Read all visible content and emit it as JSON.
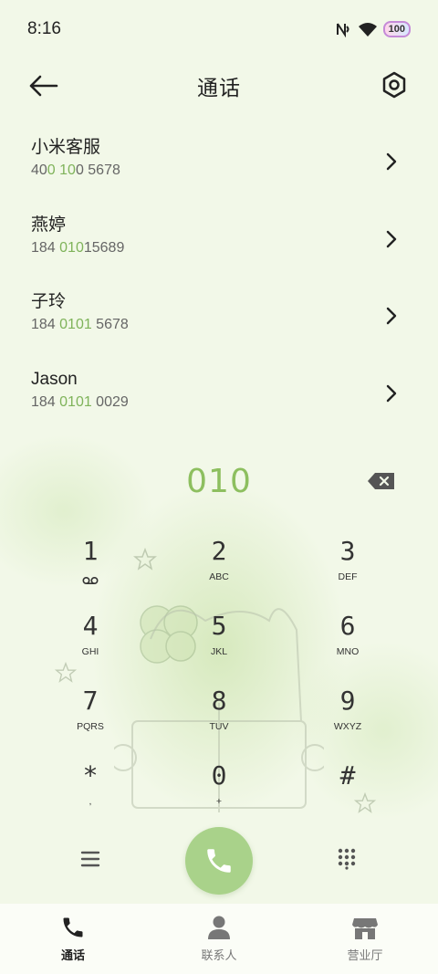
{
  "status_bar": {
    "time": "8:16",
    "battery": "100",
    "icons": [
      "nfc-icon",
      "wifi-icon",
      "battery-icon"
    ]
  },
  "header": {
    "title": "通话",
    "back_icon": "back-arrow-icon",
    "settings_icon": "settings-icon"
  },
  "contacts": [
    {
      "name": "小米客服",
      "number_parts": [
        "40",
        "0 10",
        "0 5678"
      ]
    },
    {
      "name": "燕婷",
      "number_parts": [
        "184 ",
        "010",
        "15689"
      ]
    },
    {
      "name": "子玲",
      "number_parts": [
        "184 ",
        "0101",
        " 5678"
      ]
    },
    {
      "name": "Jason",
      "number_parts": [
        "184 ",
        "0101",
        " 0029"
      ]
    }
  ],
  "dialer": {
    "dialed": "010",
    "keys": [
      {
        "digit": "1",
        "letters": "voicemail"
      },
      {
        "digit": "2",
        "letters": "ABC"
      },
      {
        "digit": "3",
        "letters": "DEF"
      },
      {
        "digit": "4",
        "letters": "GHI"
      },
      {
        "digit": "5",
        "letters": "JKL"
      },
      {
        "digit": "6",
        "letters": "MNO"
      },
      {
        "digit": "7",
        "letters": "PQRS"
      },
      {
        "digit": "8",
        "letters": "TUV"
      },
      {
        "digit": "9",
        "letters": "WXYZ"
      },
      {
        "digit": "*",
        "letters": ","
      },
      {
        "digit": "0",
        "letters": "+"
      },
      {
        "digit": "#",
        "letters": ""
      }
    ]
  },
  "bottom_nav": [
    {
      "label": "通话",
      "icon": "phone-icon",
      "active": true
    },
    {
      "label": "联系人",
      "icon": "person-icon",
      "active": false
    },
    {
      "label": "营业厅",
      "icon": "store-icon",
      "active": false
    }
  ],
  "colors": {
    "accent": "#8dbf5f",
    "highlight": "#7fb35a",
    "call_button": "#a9d28a",
    "background": "#f2f8e8"
  }
}
